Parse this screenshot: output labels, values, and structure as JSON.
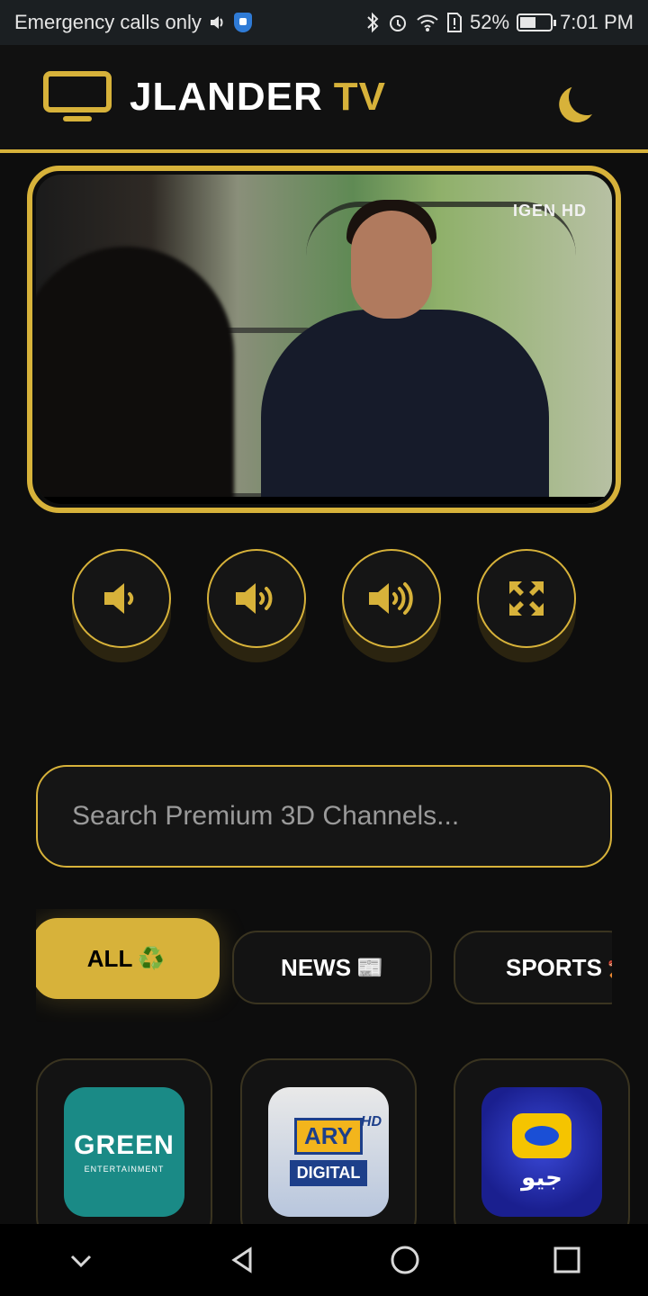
{
  "status_bar": {
    "carrier_text": "Emergency calls only",
    "battery_percent": "52%",
    "battery_level": 0.52,
    "time": "7:01 PM",
    "icons": [
      "volume-icon",
      "shield-icon",
      "bluetooth-icon",
      "alarm-icon",
      "wifi-icon",
      "sim-alert-icon",
      "battery-icon"
    ]
  },
  "header": {
    "brand_main": "JLANDER",
    "brand_accent": "TV",
    "logo_icon": "tv-icon",
    "theme_icon": "moon-icon"
  },
  "player": {
    "watermark": "IGEN HD"
  },
  "controls": [
    {
      "name": "volume-low-button",
      "icon": "volume-low-icon"
    },
    {
      "name": "volume-medium-button",
      "icon": "volume-medium-icon"
    },
    {
      "name": "volume-high-button",
      "icon": "volume-high-icon"
    },
    {
      "name": "fullscreen-button",
      "icon": "expand-icon"
    }
  ],
  "search": {
    "placeholder": "Search Premium 3D Channels..."
  },
  "tabs": [
    {
      "label": "ALL",
      "emoji": "♻️",
      "active": true
    },
    {
      "label": "NEWS",
      "emoji": "📰",
      "active": false
    },
    {
      "label": "SPORTS",
      "emoji": "🏏",
      "active": false
    }
  ],
  "channels": [
    {
      "name": "GREEN",
      "sub": "ENTERTAINMENT"
    },
    {
      "name": "ARY",
      "sub": "DIGITAL",
      "badge": "HD"
    },
    {
      "name": "جیو",
      "sub": ""
    }
  ],
  "colors": {
    "accent": "#d7b23a",
    "background": "#0d0d0d",
    "card": "#131313"
  },
  "nav": [
    "back-chevron-icon",
    "back-triangle-icon",
    "home-circle-icon",
    "recents-square-icon"
  ]
}
